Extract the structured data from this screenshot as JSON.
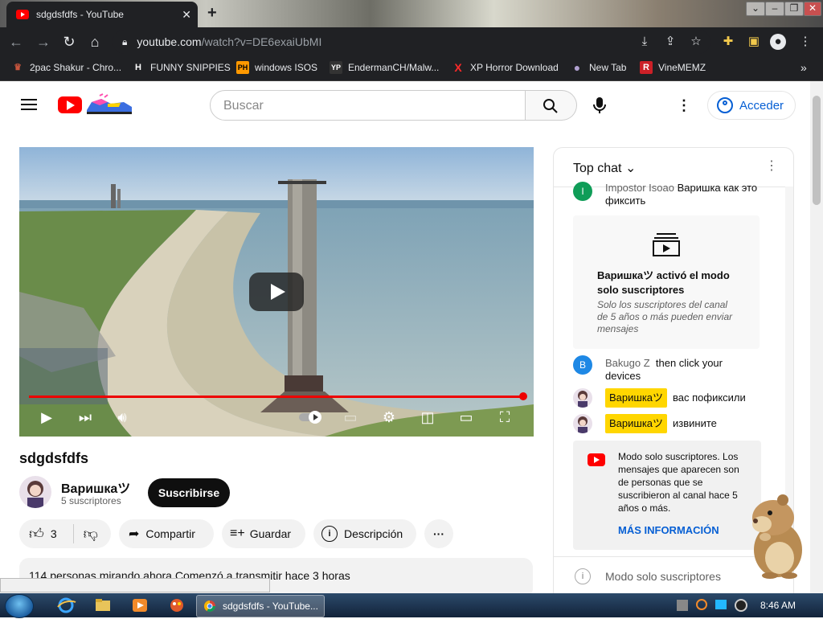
{
  "browser": {
    "tab_title": "sdgdsfdfs - YouTube",
    "url_host": "youtube.com",
    "url_path": "/watch?v=DE6exaiUbMI",
    "new_tab_symbol": "+",
    "close_symbol": "✕",
    "bookmarks": [
      {
        "label": "2pac Shakur - Chro...",
        "icon": "2pac-icon",
        "glyph": "♛",
        "color": "#c8553d"
      },
      {
        "label": "FUNNY SNIPPIES",
        "icon": "h-icon",
        "glyph": "H",
        "color": "#ffffff"
      },
      {
        "label": "windows ISOS",
        "icon": "ph-icon",
        "glyph": "PH",
        "color": "#ff9900"
      },
      {
        "label": "EndermanCH/Malw...",
        "icon": "yp-icon",
        "glyph": "YP",
        "color": "#333333"
      },
      {
        "label": "XP Horror Download",
        "icon": "x-icon",
        "glyph": "X",
        "color": "#ff2a2a"
      },
      {
        "label": "New Tab",
        "icon": "globe-icon",
        "glyph": "●",
        "color": "#b0a0d0"
      },
      {
        "label": "VineMEMZ",
        "icon": "r-icon",
        "glyph": "R",
        "color": "#cc2027"
      }
    ],
    "bookmarks_overflow": "»"
  },
  "youtube": {
    "search_placeholder": "Buscar",
    "signin_label": "Acceder",
    "brand_red": "#ff0000",
    "accent_blue": "#065fd4"
  },
  "video": {
    "title": "sdgdsfdfs",
    "channel_name": "Варишкаツ",
    "subscribers": "5 suscriptores",
    "subscribe_label": "Suscribirse",
    "like_count": "3",
    "share_label": "Compartir",
    "save_label": "Guardar",
    "description_label": "Descripción",
    "more_label": "···",
    "info_line": "114 personas mirando ahora  Comenzó a transmitir hace 3 horas",
    "progress_fraction": 1.0
  },
  "chat": {
    "header_label": "Top chat",
    "messages": [
      {
        "author": "Impostor Isoao",
        "text": "Варишка как это фиксить",
        "avatar_letter": "I",
        "avatar_color": "#0f9d58"
      },
      {
        "author": "Bakugo Z",
        "text": "then click your devices",
        "avatar_letter": "B",
        "avatar_color": "#1e88e5"
      },
      {
        "author": "Варишкаツ",
        "text": "вас пофиксили"
      },
      {
        "author": "Варишкаツ",
        "text": "извините"
      }
    ],
    "members_notice": {
      "title": "Варишкаツ activó el modo solo suscriptores",
      "body": "Solo los suscriptores del canal de 5 años o más pueden enviar mensajes"
    },
    "subscribers_banner": {
      "text": "Modo solo suscriptores. Los mensajes que aparecen son de personas que se suscribieron al canal hace 5 años o más.",
      "link": "MÁS INFORMACIÓN"
    },
    "footer_label": "Modo solo suscriptores"
  },
  "taskbar": {
    "task_label": "sdgdsfdfs - YouTube...",
    "time": "8:46 AM"
  }
}
